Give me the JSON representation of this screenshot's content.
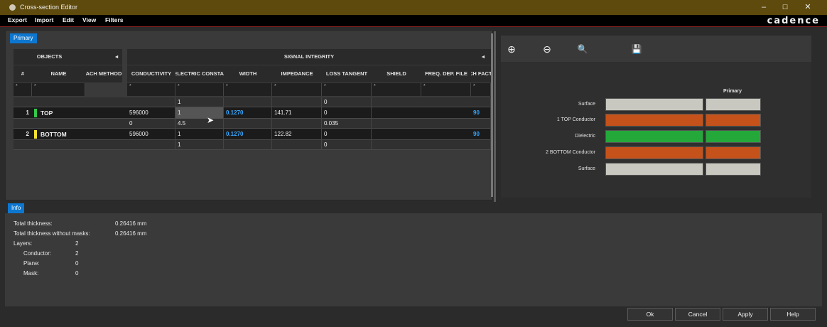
{
  "window": {
    "title": "Cross-section Editor",
    "controls": {
      "minimize": "–",
      "maximize": "☐",
      "close": "✕"
    }
  },
  "menu": {
    "items": [
      "Export",
      "Import",
      "Edit",
      "View",
      "Filters"
    ],
    "brand": "cadence"
  },
  "left_panel": {
    "tab": "Primary",
    "groups": {
      "objects": "OBJECTS",
      "signal_integrity": "SIGNAL INTEGRITY",
      "collapse": "◂"
    },
    "columns": {
      "num": "#",
      "name": "NAME",
      "method": "ACH METHOD",
      "conductivity": "CONDUCTIVITY",
      "dielectric": "DIELECTRIC CONSTANT",
      "width": "WIDTH",
      "impedance": "IMPEDANCE",
      "loss_tangent": "LOSS TANGENT",
      "shield": "SHIELD",
      "freq": "FREQ. DEP. FILE",
      "etch": "ETCH FACTOR"
    },
    "filter_symbol": "*",
    "rows": [
      {
        "num": "",
        "name": "",
        "conductivity": "",
        "dielectric": "1",
        "width": "",
        "impedance": "",
        "loss": "0",
        "etch": ""
      },
      {
        "num": "1",
        "name": "TOP",
        "color": "#34c94a",
        "conductivity": "596000",
        "dielectric": "1",
        "width": "0.1270",
        "impedance": "141.71",
        "loss": "0",
        "etch": "90"
      },
      {
        "num": "",
        "name": "",
        "conductivity": "0",
        "dielectric": "4.5",
        "width": "",
        "impedance": "",
        "loss": "0.035",
        "etch": ""
      },
      {
        "num": "2",
        "name": "BOTTOM",
        "color": "#f2e330",
        "conductivity": "596000",
        "dielectric": "1",
        "width": "0.1270",
        "impedance": "122.82",
        "loss": "0",
        "etch": "90"
      },
      {
        "num": "",
        "name": "",
        "conductivity": "",
        "dielectric": "1",
        "width": "",
        "impedance": "",
        "loss": "0",
        "etch": ""
      }
    ]
  },
  "right_panel": {
    "tools": {
      "zoom_in": "⊕",
      "zoom_out": "⊖",
      "zoom_fit": "🔍",
      "save": "💾"
    },
    "column_header": "Primary",
    "layers": [
      {
        "label": "Surface",
        "color": "#c8c8c0"
      },
      {
        "label": "1   TOP Conductor",
        "color": "#c5521a"
      },
      {
        "label": "Dielectric",
        "color": "#25a83a"
      },
      {
        "label": "2   BOTTOM Conductor",
        "color": "#c5521a"
      },
      {
        "label": "Surface",
        "color": "#c8c8c0"
      }
    ]
  },
  "info": {
    "tab": "Info",
    "total_thickness_label": "Total thickness:",
    "total_thickness": "0.26416 mm",
    "without_masks_label": "Total thickness without masks:",
    "without_masks": "0.26416 mm",
    "layers_label": "Layers:",
    "layers": "2",
    "conductor_label": "Conductor:",
    "conductor": "2",
    "plane_label": "Plane:",
    "plane": "0",
    "mask_label": "Mask:",
    "mask": "0"
  },
  "buttons": {
    "ok": "Ok",
    "cancel": "Cancel",
    "apply": "Apply",
    "help": "Help"
  }
}
